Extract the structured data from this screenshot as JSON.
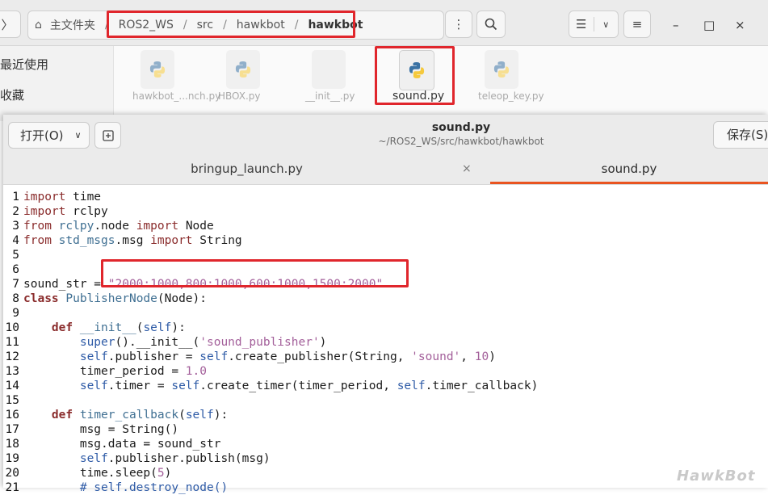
{
  "file_manager": {
    "path": [
      "主文件夹",
      "ROS2_WS",
      "src",
      "hawkbot",
      "hawkbot"
    ],
    "sidebar": [
      "最近使用",
      "收藏"
    ],
    "files": [
      {
        "name": "hawkbot_...nch.py",
        "highlighted": false
      },
      {
        "name": "HBOX.py",
        "highlighted": false
      },
      {
        "name": "__init__.py",
        "highlighted": false
      },
      {
        "name": "sound.py",
        "highlighted": true
      },
      {
        "name": "teleop_key.py",
        "highlighted": false
      }
    ],
    "window_controls": {
      "minimize": "–",
      "maximize": "□",
      "close": "×"
    }
  },
  "editor": {
    "open_label": "打开(O)",
    "save_label": "保存(S)",
    "title": "sound.py",
    "subtitle": "~/ROS2_WS/src/hawkbot/hawkbot",
    "tabs": [
      {
        "label": "bringup_launch.py",
        "active": false
      },
      {
        "label": "sound.py",
        "active": true
      }
    ],
    "accent_color": "#e95420",
    "highlight_color": "#e0262c",
    "lines": [
      "import time",
      "import rclpy",
      "from rclpy.node import Node",
      "from std_msgs.msg import String",
      "",
      "",
      "sound_str = \"2000:1000,800:1000,600:1000,1500:2000\"",
      "class PublisherNode(Node):",
      "",
      "    def __init__(self):",
      "        super().__init__('sound_publisher')",
      "        self.publisher = self.create_publisher(String, 'sound', 10)",
      "        timer_period = 1.0",
      "        self.timer = self.create_timer(timer_period, self.timer_callback)",
      "",
      "    def timer_callback(self):",
      "        msg = String()",
      "        msg.data = sound_str",
      "        self.publisher.publish(msg)",
      "        time.sleep(5)",
      "        # self.destroy_node()"
    ]
  },
  "watermark": "HawkBot"
}
